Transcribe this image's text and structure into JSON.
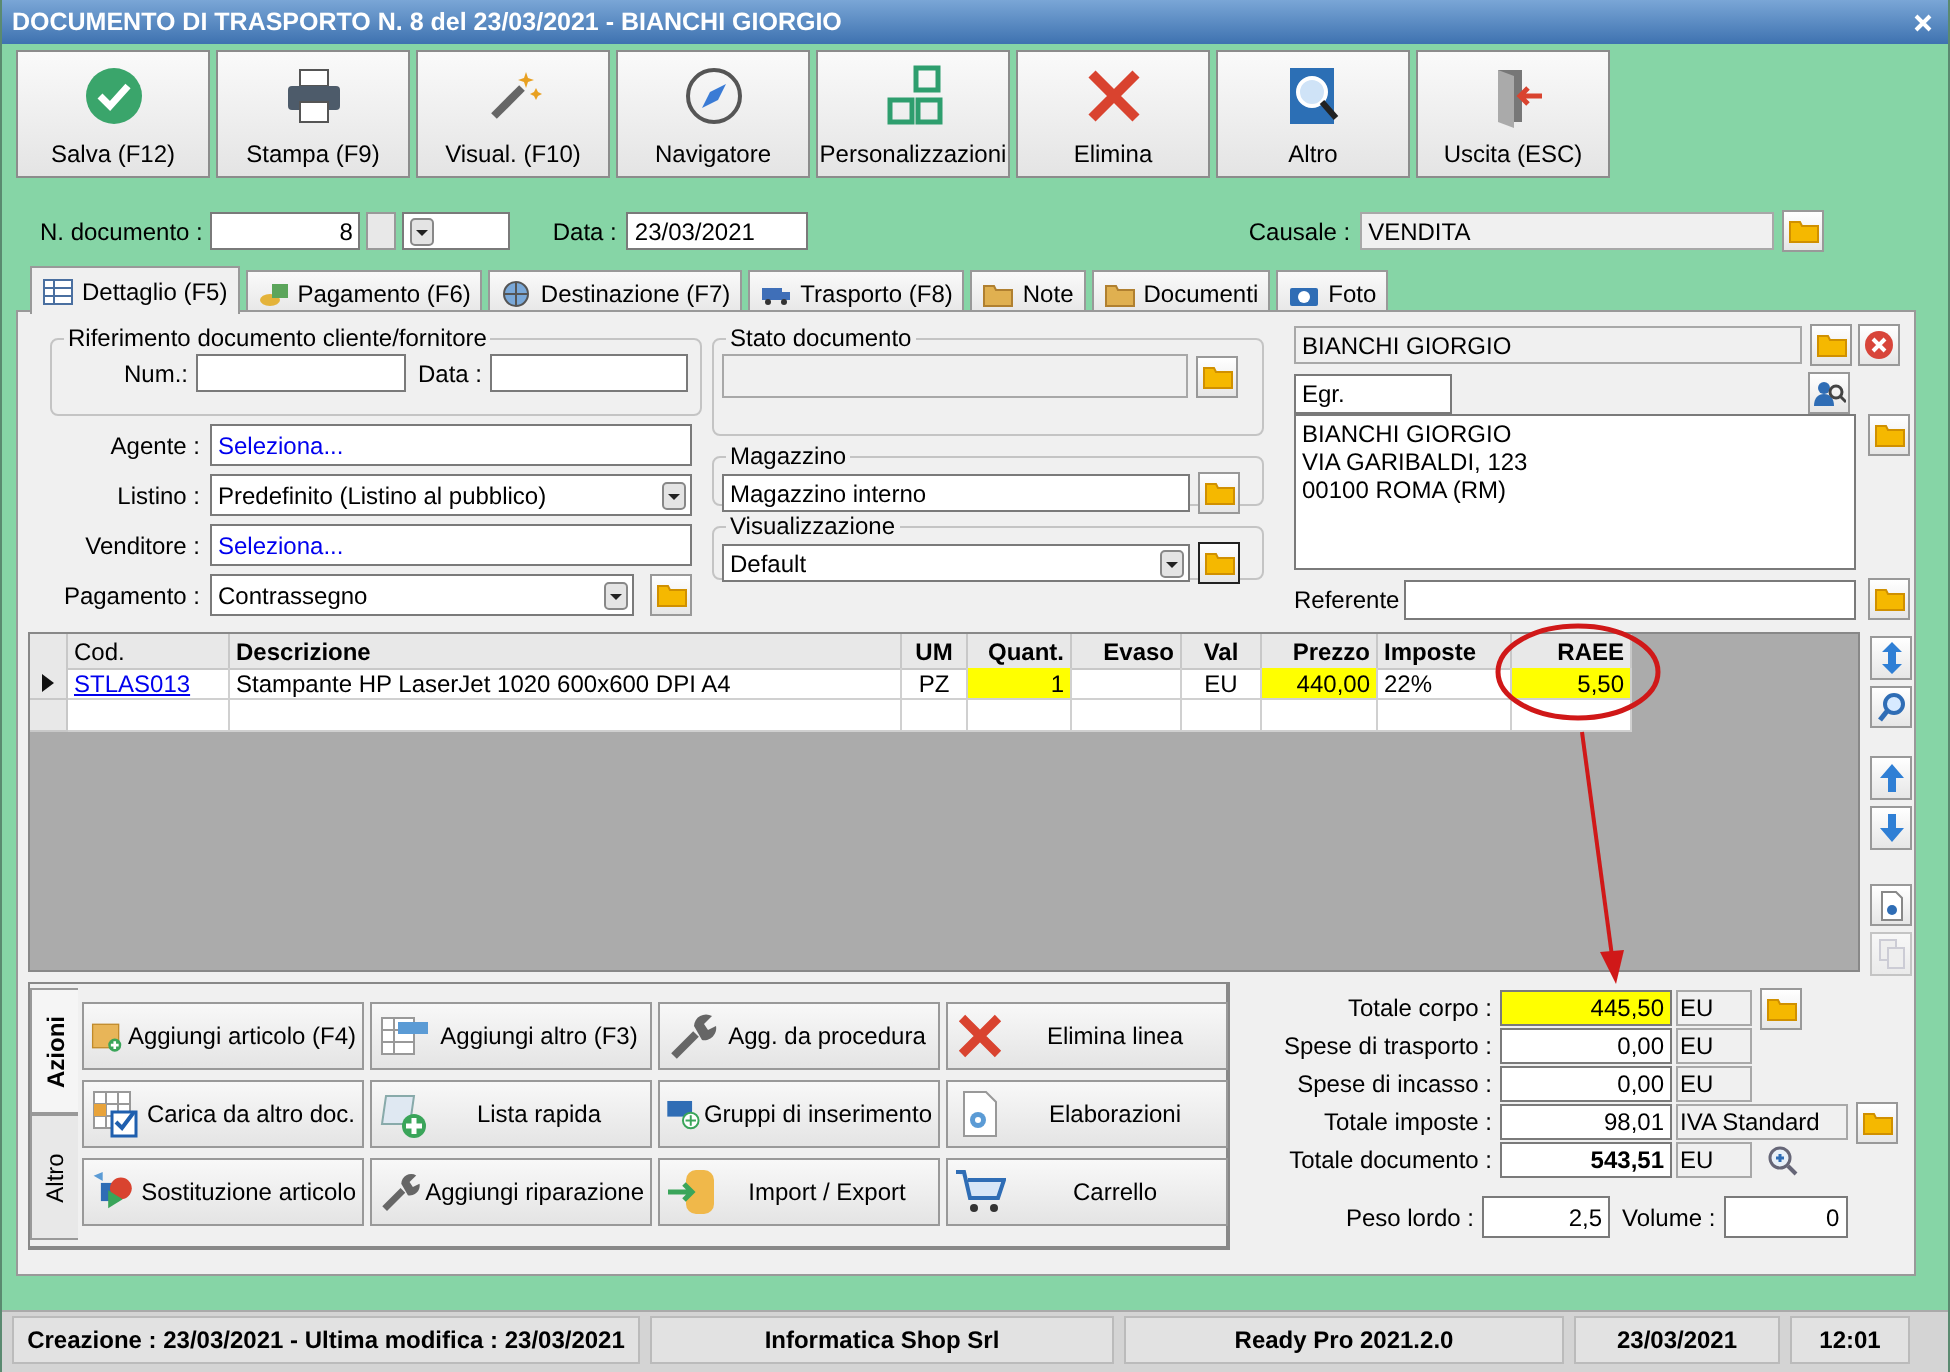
{
  "window": {
    "title": "DOCUMENTO DI TRASPORTO N. 8 del 23/03/2021 - BIANCHI GIORGIO"
  },
  "toolbar": [
    "Salva (F12)",
    "Stampa (F9)",
    "Visual. (F10)",
    "Navigatore",
    "Personalizzazioni",
    "Elimina",
    "Altro",
    "Uscita (ESC)"
  ],
  "header": {
    "doc_number_label": "N. documento :",
    "doc_number": "8",
    "date_label": "Data :",
    "date": "23/03/2021",
    "causale_label": "Causale :",
    "causale": "VENDITA"
  },
  "tabs": [
    {
      "label": "Dettaglio (F5)",
      "selected": true
    },
    {
      "label": "Pagamento (F6)",
      "selected": false
    },
    {
      "label": "Destinazione (F7)",
      "selected": false
    },
    {
      "label": "Trasporto (F8)",
      "selected": false
    },
    {
      "label": "Note",
      "selected": false
    },
    {
      "label": "Documenti",
      "selected": false
    },
    {
      "label": "Foto",
      "selected": false
    }
  ],
  "reference": {
    "title": "Riferimento documento cliente/fornitore",
    "num_label": "Num.:",
    "date_label": "Data :"
  },
  "fields": [
    {
      "label": "Agente :",
      "value": "Seleziona...",
      "kind": "picker"
    },
    {
      "label": "Listino :",
      "value": "Predefinito (Listino al pubblico)",
      "kind": "select"
    },
    {
      "label": "Venditore :",
      "value": "Seleziona...",
      "kind": "picker"
    },
    {
      "label": "Pagamento :",
      "value": "Contrassegno",
      "kind": "select"
    }
  ],
  "stato": {
    "title": "Stato documento"
  },
  "magazzino": {
    "title": "Magazzino",
    "value": "Magazzino interno"
  },
  "visualizzazione": {
    "title": "Visualizzazione",
    "value": "Default"
  },
  "customer": {
    "name": "BIANCHI GIORGIO",
    "salutation": "Egr.",
    "address": [
      "BIANCHI GIORGIO",
      "VIA GARIBALDI, 123",
      "00100 ROMA (RM)"
    ],
    "referente_label": "Referente"
  },
  "table": {
    "columns": [
      "Cod.",
      "Descrizione",
      "UM",
      "Quant.",
      "Evaso",
      "Val",
      "Prezzo",
      "Imposte",
      "RAEE"
    ],
    "rows": [
      {
        "selected": true,
        "cod": "STLAS013",
        "descrizione": "Stampante HP LaserJet 1020 600x600 DPI A4",
        "um": "PZ",
        "quant": "1",
        "val": "EU",
        "prezzo": "440,00",
        "imposte": "22%",
        "raee": "5,50"
      }
    ]
  },
  "side_tabs": [
    {
      "label": "Azioni",
      "selected": true
    },
    {
      "label": "Altro",
      "selected": false
    }
  ],
  "actions": [
    "Aggiungi articolo (F4)",
    "Aggiungi altro (F3)",
    "Agg. da procedura",
    "Elimina linea",
    "Carica da altro doc.",
    "Lista rapida",
    "Gruppi di inserimento",
    "Elaborazioni",
    "Sostituzione articolo",
    "Aggiungi riparazione",
    "Import / Export",
    "Carrello"
  ],
  "totals": [
    {
      "label": "Totale corpo :",
      "value": "445,50",
      "unit": "EU",
      "highlighted": true,
      "bold": false
    },
    {
      "label": "Spese di trasporto :",
      "value": "0,00",
      "unit": "EU",
      "highlighted": false,
      "bold": false
    },
    {
      "label": "Spese di incasso :",
      "value": "0,00",
      "unit": "EU",
      "highlighted": false,
      "bold": false
    },
    {
      "label": "Totale imposte :",
      "value": "98,01",
      "unit": "IVA Standard",
      "highlighted": false,
      "bold": false
    },
    {
      "label": "Totale documento :",
      "value": "543,51",
      "unit": "EU",
      "highlighted": false,
      "bold": true
    }
  ],
  "weight": {
    "peso_label": "Peso lordo :",
    "peso": "2,5",
    "volume_label": "Volume :",
    "volume": "0"
  },
  "status_bar": [
    "Creazione : 23/03/2021 - Ultima modifica : 23/03/2021",
    "Informatica Shop Srl",
    "Ready Pro 2021.2.0",
    "23/03/2021",
    "12:01"
  ]
}
